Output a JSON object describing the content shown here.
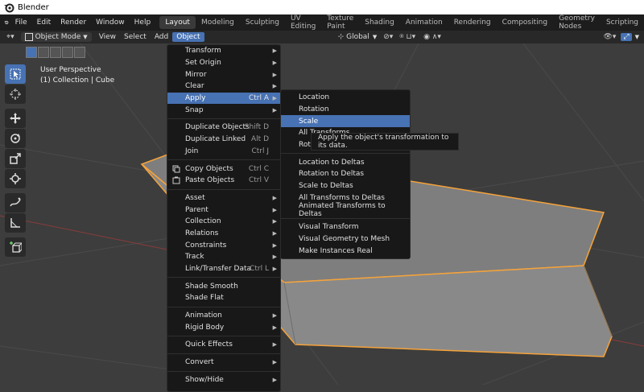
{
  "window": {
    "title": "Blender"
  },
  "menubar": {
    "items": [
      "File",
      "Edit",
      "Render",
      "Window",
      "Help"
    ],
    "workspaces": [
      "Layout",
      "Modeling",
      "Sculpting",
      "UV Editing",
      "Texture Paint",
      "Shading",
      "Animation",
      "Rendering",
      "Compositing",
      "Geometry Nodes",
      "Scripting"
    ],
    "active_workspace": "Layout"
  },
  "header3d": {
    "mode": "Object Mode",
    "menus": [
      "View",
      "Select",
      "Add",
      "Object"
    ],
    "transform_orientation": "Global"
  },
  "viewport": {
    "perspective": "User Perspective",
    "collection_info": "(1) Collection | Cube"
  },
  "object_menu": {
    "items": [
      {
        "label": "Transform",
        "submenu": true
      },
      {
        "label": "Set Origin",
        "submenu": true
      },
      {
        "label": "Mirror",
        "submenu": true
      },
      {
        "label": "Clear",
        "submenu": true
      },
      {
        "label": "Apply",
        "shortcut": "Ctrl A",
        "submenu": true,
        "highlighted": true
      },
      {
        "label": "Snap",
        "submenu": true
      },
      {
        "sep": true
      },
      {
        "label": "Duplicate Objects",
        "shortcut": "Shift D"
      },
      {
        "label": "Duplicate Linked",
        "shortcut": "Alt D"
      },
      {
        "label": "Join",
        "shortcut": "Ctrl J"
      },
      {
        "sep": true
      },
      {
        "label": "Copy Objects",
        "shortcut": "Ctrl C",
        "icon": "copy-icon"
      },
      {
        "label": "Paste Objects",
        "shortcut": "Ctrl V",
        "icon": "paste-icon"
      },
      {
        "sep": true
      },
      {
        "label": "Asset",
        "submenu": true
      },
      {
        "label": "Parent",
        "submenu": true
      },
      {
        "label": "Collection",
        "submenu": true
      },
      {
        "label": "Relations",
        "submenu": true
      },
      {
        "label": "Constraints",
        "submenu": true
      },
      {
        "label": "Track",
        "submenu": true
      },
      {
        "label": "Link/Transfer Data",
        "shortcut": "Ctrl L",
        "submenu": true
      },
      {
        "sep": true
      },
      {
        "label": "Shade Smooth"
      },
      {
        "label": "Shade Flat"
      },
      {
        "sep": true
      },
      {
        "label": "Animation",
        "submenu": true
      },
      {
        "label": "Rigid Body",
        "submenu": true
      },
      {
        "sep": true
      },
      {
        "label": "Quick Effects",
        "submenu": true
      },
      {
        "sep": true
      },
      {
        "label": "Convert",
        "submenu": true
      },
      {
        "sep": true
      },
      {
        "label": "Show/Hide",
        "submenu": true
      }
    ]
  },
  "apply_menu": {
    "items": [
      {
        "label": "Location"
      },
      {
        "label": "Rotation"
      },
      {
        "label": "Scale",
        "highlighted": true
      },
      {
        "label": "All Transforms"
      },
      {
        "label": "Rotation & Scale"
      },
      {
        "sep": true
      },
      {
        "label": "Location to Deltas"
      },
      {
        "label": "Rotation to Deltas"
      },
      {
        "label": "Scale to Deltas"
      },
      {
        "label": "All Transforms to Deltas"
      },
      {
        "label": "Animated Transforms to Deltas"
      },
      {
        "sep": true
      },
      {
        "label": "Visual Transform"
      },
      {
        "label": "Visual Geometry to Mesh"
      },
      {
        "label": "Make Instances Real"
      }
    ]
  },
  "tooltip": {
    "text": "Apply the object's transformation to its data."
  },
  "colors": {
    "accent": "#4772b3",
    "selection_outline": "#f5a33a",
    "menu_bg": "#181818"
  }
}
